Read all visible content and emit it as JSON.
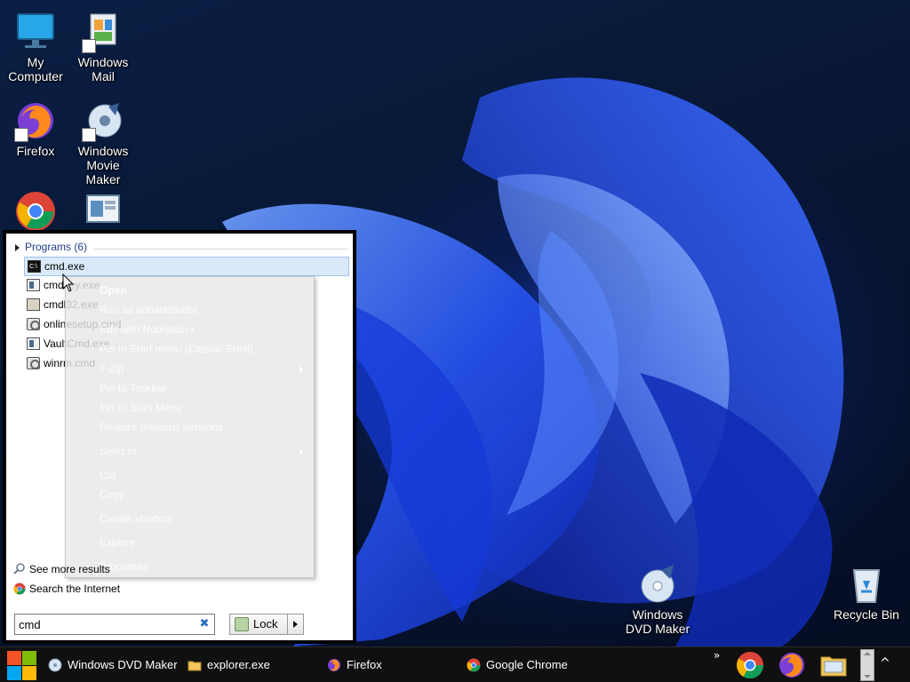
{
  "desktop": {
    "icons": [
      {
        "label": "My\nComputer",
        "icon": "monitor-icon"
      },
      {
        "label": "Windows\nMail",
        "icon": "mail-icon"
      },
      {
        "label": "Firefox",
        "icon": "firefox-icon"
      },
      {
        "label": "Windows\nMovie Maker",
        "icon": "movie-maker-icon"
      },
      {
        "label": "",
        "icon": "chrome-icon"
      },
      {
        "label": "",
        "icon": "window-app-icon"
      },
      {
        "label": "Windows\nDVD Maker",
        "icon": "dvd-maker-icon"
      },
      {
        "label": "Recycle Bin",
        "icon": "recycle-bin-icon"
      }
    ]
  },
  "start_menu": {
    "programs_header": "Programs (6)",
    "programs": [
      {
        "label": "cmd.exe",
        "icon": "console-icon",
        "selected": true
      },
      {
        "label": "cmdkey.exe",
        "icon": "app-icon"
      },
      {
        "label": "cmdl32.exe",
        "icon": "pen-icon"
      },
      {
        "label": "onlinesetup.cmd",
        "icon": "gear-script-icon"
      },
      {
        "label": "VaultCmd.exe",
        "icon": "app-icon"
      },
      {
        "label": "winrm.cmd",
        "icon": "gear-script-icon"
      }
    ],
    "context_menu": [
      {
        "label": "Open",
        "bold": true
      },
      {
        "label": "Run as administrator"
      },
      {
        "label": "Edit with Notepad++"
      },
      {
        "label": "Pin to Start menu (Classic Shell)"
      },
      {
        "label": "7-Zip",
        "submenu": true
      },
      {
        "label": "Pin to Taskbar"
      },
      {
        "label": "Pin to Start Menu"
      },
      {
        "label": "Restore previous versions"
      },
      {
        "label": "Send to",
        "submenu": true
      },
      {
        "label": "Cut"
      },
      {
        "label": "Copy"
      },
      {
        "label": "Create shortcut"
      },
      {
        "label": "Explore"
      },
      {
        "label": "Properties"
      }
    ],
    "see_more": "See more results",
    "search_internet": "Search the Internet",
    "search_value": "cmd",
    "lock_label": "Lock"
  },
  "taskbar": {
    "items": [
      {
        "label": "Windows DVD Maker",
        "icon": "dvd-maker-icon"
      },
      {
        "label": "explorer.exe",
        "icon": "folder-icon"
      },
      {
        "label": "Firefox",
        "icon": "firefox-icon"
      },
      {
        "label": "Google Chrome",
        "icon": "chrome-icon"
      }
    ],
    "overflow": "»",
    "pinned": [
      "chrome-icon",
      "firefox-icon",
      "file-explorer-icon"
    ],
    "tray_toggle": "^"
  },
  "colors": {
    "accent": "#1e3e8a",
    "selection": "#dbe9fa",
    "taskbar": "#101010"
  }
}
